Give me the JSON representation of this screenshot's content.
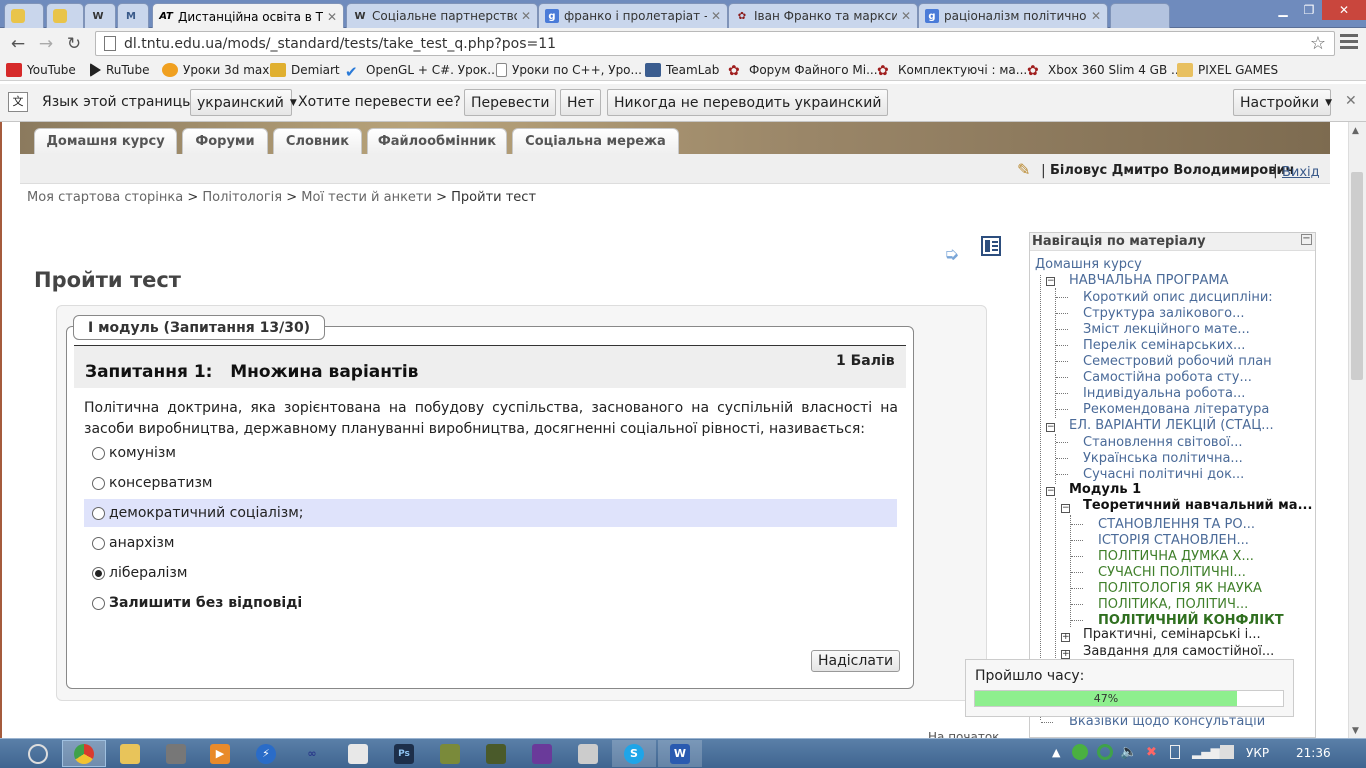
{
  "browser": {
    "tabs": [
      {
        "title": "",
        "active": false
      },
      {
        "title": "",
        "active": false
      },
      {
        "title": "",
        "active": false
      },
      {
        "title": "",
        "active": false
      },
      {
        "title": "Дистанційна освіта в ТНТ",
        "active": true,
        "favicon": "AT"
      },
      {
        "title": "Соціальне партнерство –",
        "active": false,
        "favicon": "W"
      },
      {
        "title": "франко і пролетаріат - По",
        "active": false,
        "favicon": "g"
      },
      {
        "title": "Іван Франко та марксизм",
        "active": false,
        "favicon": "flower"
      },
      {
        "title": "раціоналізм політичного",
        "active": false,
        "favicon": "g"
      }
    ],
    "url": "dl.tntu.edu.ua/mods/_standard/tests/take_test_q.php?pos=11",
    "bookmarks": [
      "YouTube",
      "RuTube",
      "Уроки 3d max",
      "Demiart",
      "OpenGL + C#. Урок...",
      "Уроки по C++, Уро...",
      "TeamLab",
      "Форум Файного Мі...",
      "Комплектуючі : ма...",
      "Xbox 360 Slim 4 GB ...",
      "PIXEL GAMES"
    ]
  },
  "translate_bar": {
    "text1": "Язык этой страницы",
    "language": "украинский",
    "text2": "Хотите перевести ее?",
    "translate": "Перевести",
    "no": "Нет",
    "never": "Никогда не переводить украинский",
    "settings": "Настройки"
  },
  "course_tabs": [
    "Домашня курсу",
    "Форуми",
    "Словник",
    "Файлообмінник",
    "Соціальна мережа"
  ],
  "user": {
    "name": "Біловус Дмитро Володимирович",
    "separator": "|",
    "logout": "Вихід"
  },
  "breadcrumb": [
    "Моя стартова сторінка",
    "Політологія",
    "Мої тести й анкети",
    "Пройти тест"
  ],
  "page_title": "Пройти тест",
  "test": {
    "legend": "І модуль (Запитання 13/30)",
    "question_label": "Запитання 1:",
    "question_type": "Множина варіантів",
    "points": "1 Балів",
    "text": "Політична доктрина, яка зорієнтована на побудову суспільства, заснованого на суспільній власності на засоби виробництва, державному плануванні виробництва, досягненні соціальної рівності, називається:",
    "options": [
      {
        "label": "комунізм",
        "selected": false,
        "bold": false
      },
      {
        "label": "консерватизм",
        "selected": false,
        "bold": false
      },
      {
        "label": "демократичний соціалізм;",
        "selected": false,
        "bold": false,
        "highlight": true
      },
      {
        "label": "анархізм",
        "selected": false,
        "bold": false
      },
      {
        "label": "лібералізм",
        "selected": true,
        "bold": false
      },
      {
        "label": "Залишити без відповіді",
        "selected": false,
        "bold": true
      }
    ],
    "submit": "Надіслати"
  },
  "nav": {
    "title": "Навігація по матеріалу",
    "home": "Домашня курсу",
    "items": [
      {
        "label": "НАВЧАЛЬНА ПРОГРАМА",
        "style": "lk",
        "box": "-"
      },
      {
        "label": "Короткий опис дисципліни:",
        "style": "lk"
      },
      {
        "label": "Структура залікового...",
        "style": "lk"
      },
      {
        "label": "Зміст лекційного мате...",
        "style": "lk"
      },
      {
        "label": "Перелік семінарських...",
        "style": "lk"
      },
      {
        "label": "Семестровий робочий план",
        "style": "lk"
      },
      {
        "label": "Самостійна робота сту...",
        "style": "lk"
      },
      {
        "label": "Індивідуальна робота...",
        "style": "lk"
      },
      {
        "label": "Рекомендована література",
        "style": "lk"
      },
      {
        "label": "ЕЛ. ВАРІАНТИ ЛЕКЦІЙ (СТАЦ...",
        "style": "lk",
        "box": "-"
      },
      {
        "label": "Становлення світової...",
        "style": "lk"
      },
      {
        "label": "Українська політична...",
        "style": "lk"
      },
      {
        "label": "Сучасні політичні док...",
        "style": "lk"
      },
      {
        "label": "Модуль 1",
        "style": "bd",
        "box": "-"
      },
      {
        "label": "Теоретичний навчальний ма...",
        "style": "bd",
        "box": "-"
      },
      {
        "label": "СТАНОВЛЕННЯ ТА РО...",
        "style": "lk"
      },
      {
        "label": "ІСТОРІЯ СТАНОВЛЕН...",
        "style": "lk"
      },
      {
        "label": "ПОЛІТИЧНА ДУМКА Х...",
        "style": "gr"
      },
      {
        "label": "СУЧАСНІ ПОЛІТИЧНІ...",
        "style": "gr"
      },
      {
        "label": "ПОЛІТОЛОГІЯ ЯК НАУКА",
        "style": "gr"
      },
      {
        "label": "ПОЛІТИКА, ПОЛІТИЧ...",
        "style": "gr"
      },
      {
        "label": "ПОЛІТИЧНИЙ КОНФЛІКТ",
        "style": "gbd"
      },
      {
        "label": "Практичні, семінарські і...",
        "style": "plain",
        "box": "+"
      },
      {
        "label": "Завдання для самостійної...",
        "style": "plain",
        "box": "+"
      },
      {
        "label": "Вказівки щодо консультацій",
        "style": "lk"
      }
    ],
    "top_link": "На початок"
  },
  "timer": {
    "label": "Пройшло часу:",
    "percent_text": "47%",
    "progress": 0.85
  },
  "taskbar": {
    "language": "УКР",
    "time": "21:36"
  }
}
